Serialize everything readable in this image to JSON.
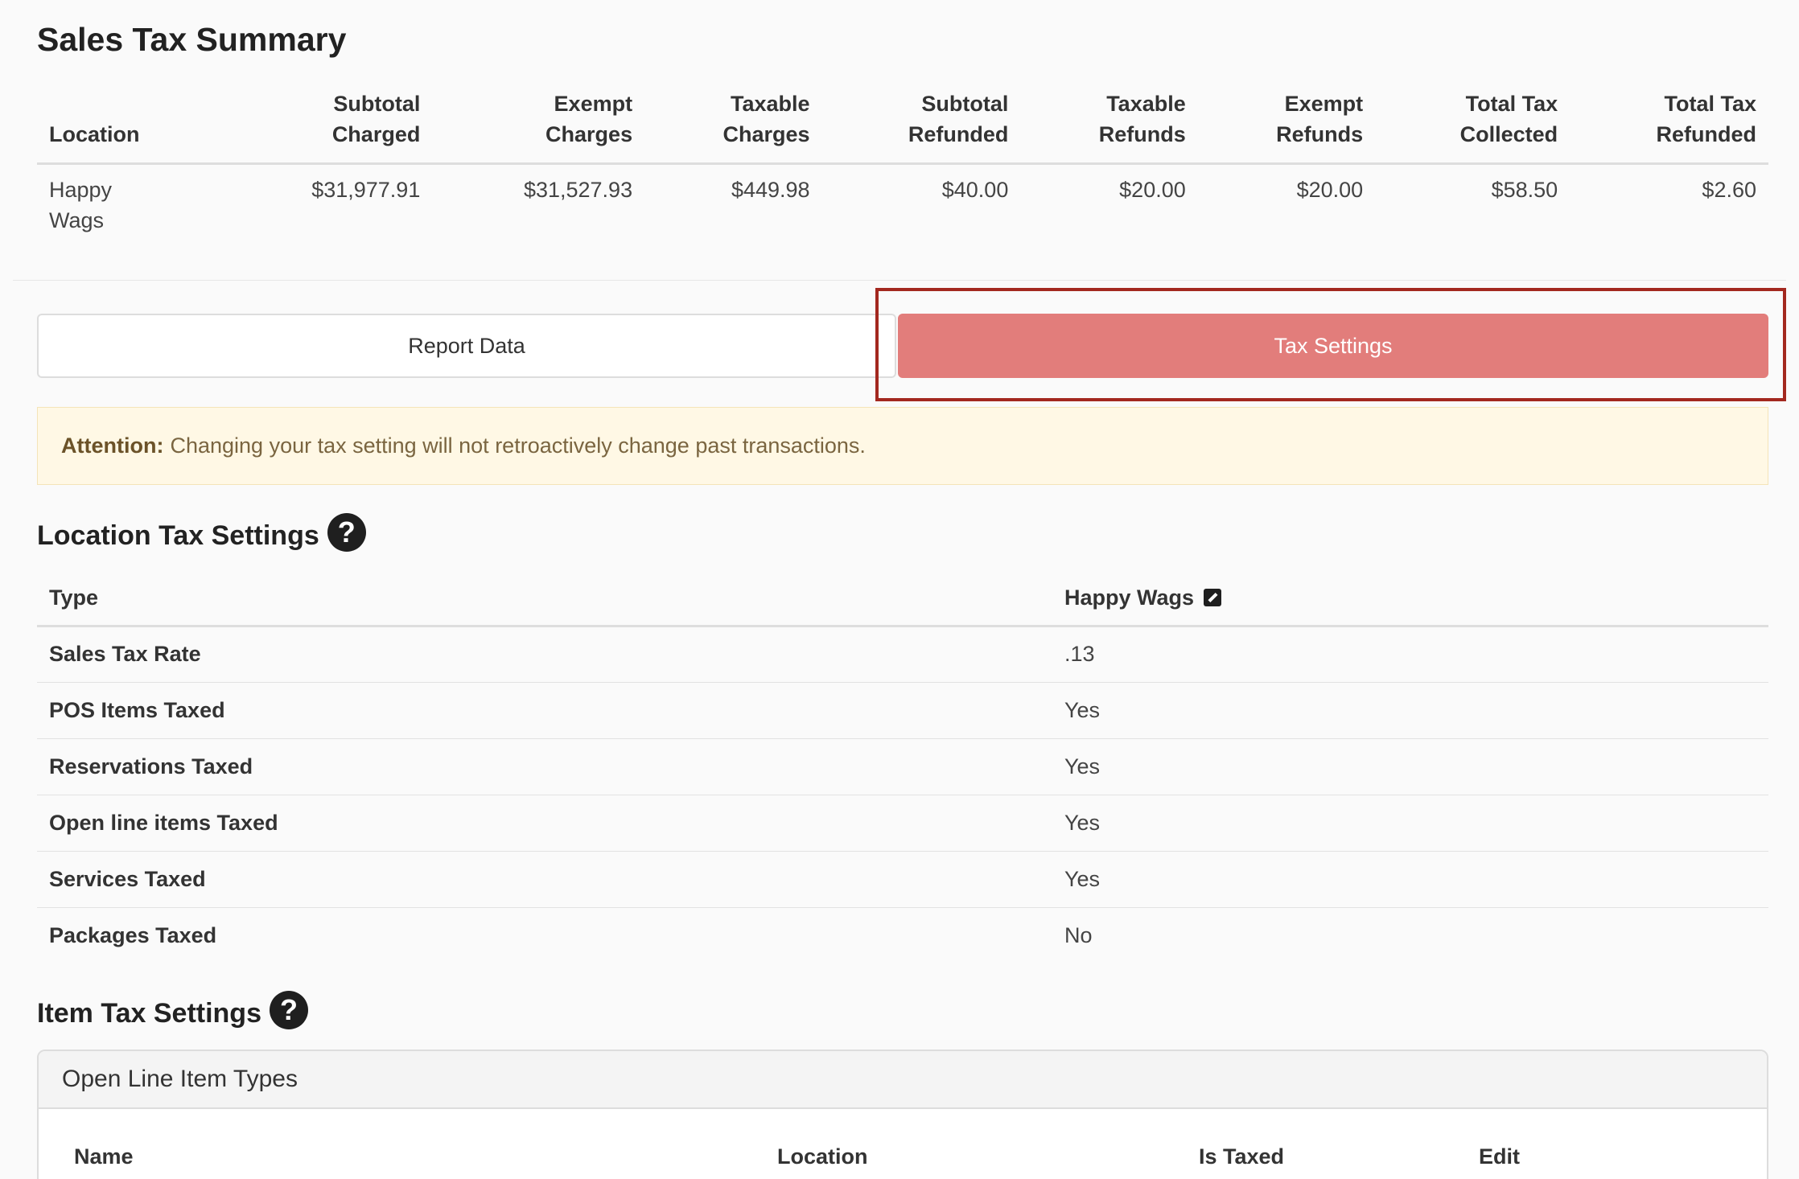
{
  "summary": {
    "title": "Sales Tax Summary",
    "columns": [
      {
        "line1": "",
        "line2": "Location"
      },
      {
        "line1": "Subtotal",
        "line2": "Charged"
      },
      {
        "line1": "Exempt",
        "line2": "Charges"
      },
      {
        "line1": "Taxable",
        "line2": "Charges"
      },
      {
        "line1": "Subtotal",
        "line2": "Refunded"
      },
      {
        "line1": "Taxable",
        "line2": "Refunds"
      },
      {
        "line1": "Exempt",
        "line2": "Refunds"
      },
      {
        "line1": "Total Tax",
        "line2": "Collected"
      },
      {
        "line1": "Total Tax",
        "line2": "Refunded"
      }
    ],
    "row": {
      "location_line1": "Happy",
      "location_line2": "Wags",
      "values": [
        "$31,977.91",
        "$31,527.93",
        "$449.98",
        "$40.00",
        "$20.00",
        "$20.00",
        "$58.50",
        "$2.60"
      ]
    }
  },
  "tabs": {
    "report_data": "Report Data",
    "tax_settings": "Tax Settings",
    "active": "tax_settings"
  },
  "attention": {
    "label": "Attention:",
    "message": "Changing your tax setting will not retroactively change past transactions."
  },
  "location_tax": {
    "title": "Location Tax Settings",
    "help_icon": "question-circle-icon",
    "header_type": "Type",
    "header_location": "Happy Wags",
    "edit_icon": "edit-icon",
    "rows": [
      {
        "type": "Sales Tax Rate",
        "value": ".13"
      },
      {
        "type": "POS Items Taxed",
        "value": "Yes"
      },
      {
        "type": "Reservations Taxed",
        "value": "Yes"
      },
      {
        "type": "Open line items Taxed",
        "value": "Yes"
      },
      {
        "type": "Services Taxed",
        "value": "Yes"
      },
      {
        "type": "Packages Taxed",
        "value": "No"
      }
    ]
  },
  "item_tax": {
    "title": "Item Tax Settings",
    "help_icon": "question-circle-icon",
    "panel_title": "Open Line Item Types",
    "columns": [
      "Name",
      "Location",
      "Is Taxed",
      "Edit"
    ]
  },
  "colors": {
    "active_tab": "#e27d7b",
    "highlight_border": "#a3281f",
    "attention_bg": "#fff8e5"
  }
}
